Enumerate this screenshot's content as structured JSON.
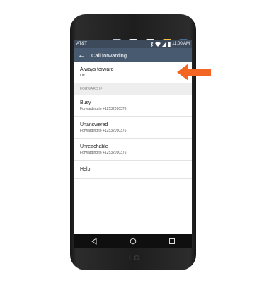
{
  "status_bar": {
    "carrier": "AT&T",
    "time": "11:00 AM"
  },
  "action_bar": {
    "title": "Call forwarding"
  },
  "always_forward": {
    "title": "Always forward",
    "status": "Off"
  },
  "section_header": "FORWARD IF",
  "items": [
    {
      "title": "Busy",
      "subtitle": "Forwarding to +12532090376"
    },
    {
      "title": "Unanswered",
      "subtitle": "Forwarding to +12532090376"
    },
    {
      "title": "Unreachable",
      "subtitle": "Forwarding to +12532090376"
    },
    {
      "title": "Help"
    }
  ],
  "second_screen_icons": [
    "settings-icon",
    "accessibility-icon",
    "bag-icon",
    "folder-icon",
    "sim-icon"
  ],
  "nav_icons": [
    "back-icon",
    "home-icon",
    "recents-icon"
  ],
  "callout_color": "#f26522",
  "action_bar_color": "#485a70"
}
